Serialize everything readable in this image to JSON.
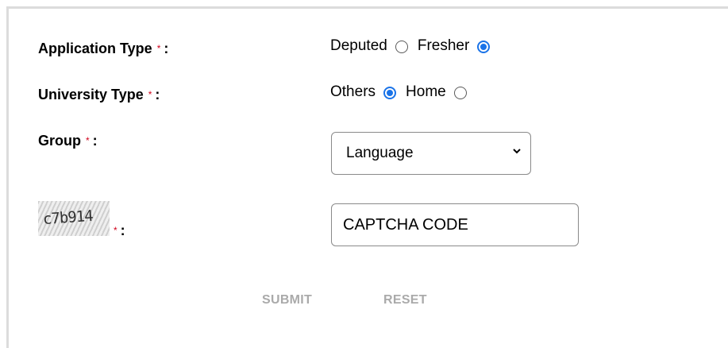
{
  "form": {
    "application_type": {
      "label": "Application Type",
      "options": [
        {
          "label": "Deputed",
          "checked": false
        },
        {
          "label": "Fresher",
          "checked": true
        }
      ]
    },
    "university_type": {
      "label": "University Type",
      "options": [
        {
          "label": "Others",
          "checked": true
        },
        {
          "label": "Home",
          "checked": false
        }
      ]
    },
    "group": {
      "label": "Group",
      "selected": "Language"
    },
    "captcha": {
      "image_text": "c7b914",
      "placeholder": "CAPTCHA CODE"
    },
    "required_mark": "*",
    "colon": ":",
    "buttons": {
      "submit": "SUBMIT",
      "reset": "RESET"
    }
  },
  "colors": {
    "accent": "#1a73e8",
    "required": "#d0021b",
    "disabled_button": "#aaaaaa"
  }
}
